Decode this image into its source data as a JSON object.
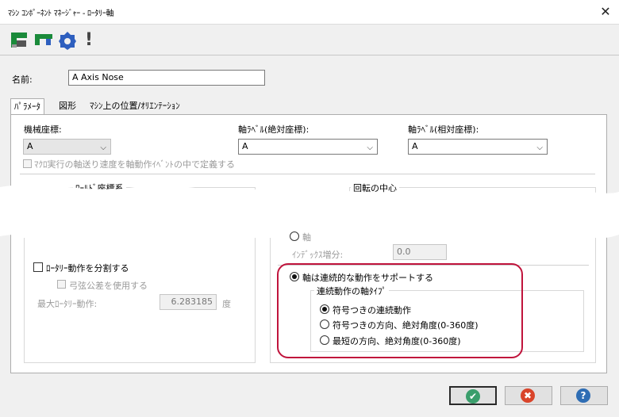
{
  "window": {
    "title": "ﾏｼﾝ ｺﾝﾎﾟｰﾈﾝﾄ ﾏﾈｰｼﾞｬｰ - ﾛｰﾀﾘｰ軸",
    "close_glyph": "✕"
  },
  "toolbar": {
    "icons": [
      "component-icon",
      "axis-icon",
      "gear-icon",
      "warning-icon"
    ],
    "warning_glyph": "!"
  },
  "name_field": {
    "label": "名前:",
    "value": "A Axis Nose"
  },
  "tabs": [
    {
      "label": "ﾊﾟﾗﾒｰﾀ",
      "active": true
    },
    {
      "label": "図形",
      "active": false
    },
    {
      "label": "ﾏｼﾝ上の位置/ｵﾘｴﾝﾃｰｼｮﾝ",
      "active": false
    }
  ],
  "params": {
    "machine_coord": {
      "label": "機械座標:",
      "value": "A"
    },
    "axis_label_abs": {
      "label": "軸ﾗﾍﾞﾙ(絶対座標):",
      "value": "A"
    },
    "axis_label_rel": {
      "label": "軸ﾗﾍﾞﾙ(相対座標):",
      "value": "A"
    },
    "macro_feed_checkbox": {
      "label": "ﾏｸﾛ実行の軸送り速度を軸動作ｲﾍﾞﾝﾄの中で定義する",
      "checked": false
    }
  },
  "sections": {
    "world_coord": "ﾜｰﾙﾄﾞ座標系",
    "rotation_center": "回転の中心",
    "partial_radio_label": "軸",
    "index_increment": {
      "label": "ｲﾝﾃﾞｯｸｽ増分:",
      "value": "0.0"
    }
  },
  "rotary_split": {
    "checkbox_label": "ﾛｰﾀﾘｰ動作を分割する",
    "chord_checkbox_label": "弓弦公差を使用する",
    "max_label": "最大ﾛｰﾀﾘｰ動作:",
    "max_value": "6.283185",
    "unit": "度"
  },
  "continuous": {
    "support_label": "軸は連続的な動作をサポートする",
    "group_title": "連続動作の軸ﾀｲﾌﾟ",
    "options": [
      {
        "label": "符号つきの連続動作",
        "selected": true
      },
      {
        "label": "符号つきの方向、絶対角度(0-360度)",
        "selected": false
      },
      {
        "label": "最短の方向、絶対角度(0-360度)",
        "selected": false
      }
    ]
  },
  "buttons": {
    "ok_glyph": "✔",
    "cancel_glyph": "✖",
    "help_glyph": "?"
  },
  "colors": {
    "highlight": "#c0143c",
    "ok": "#3a9e6c",
    "cancel": "#d9442a",
    "help": "#2e6db4"
  }
}
